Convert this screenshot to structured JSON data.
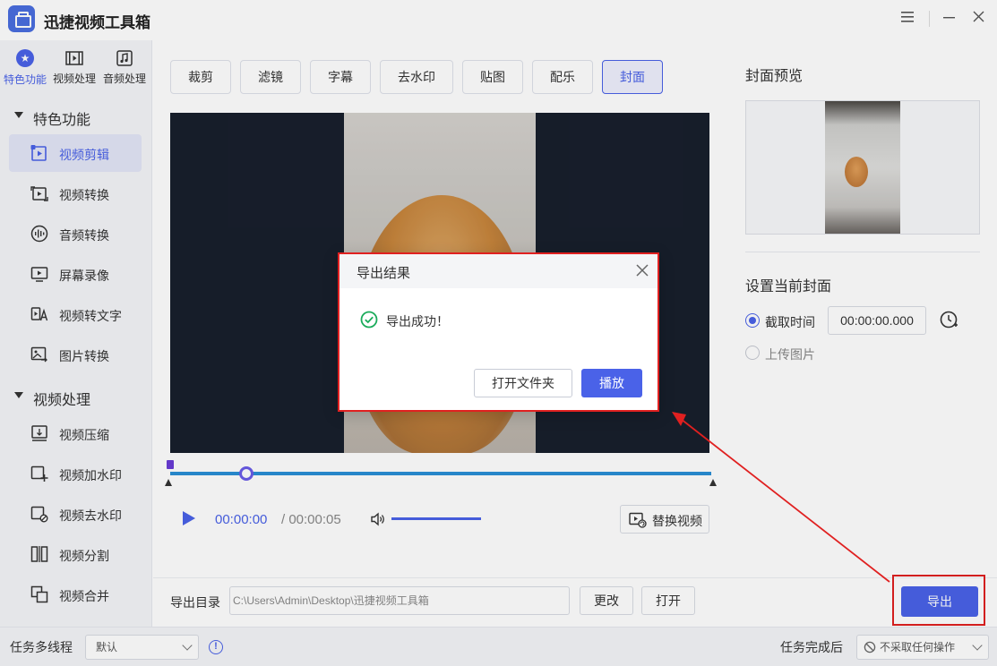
{
  "app": {
    "title": "迅捷视频工具箱"
  },
  "sidebar": {
    "top_tabs": [
      {
        "label": "特色功能",
        "icon": "star-icon",
        "active": true
      },
      {
        "label": "视频处理",
        "icon": "film-icon",
        "active": false
      },
      {
        "label": "音频处理",
        "icon": "music-icon",
        "active": false
      }
    ],
    "groups": [
      {
        "label": "特色功能",
        "items": [
          {
            "label": "视频剪辑",
            "icon": "video-edit-icon",
            "active": true
          },
          {
            "label": "视频转换",
            "icon": "video-convert-icon",
            "active": false
          },
          {
            "label": "音频转换",
            "icon": "audio-convert-icon",
            "active": false
          },
          {
            "label": "屏幕录像",
            "icon": "screen-record-icon",
            "active": false
          },
          {
            "label": "视频转文字",
            "icon": "video-to-text-icon",
            "active": false
          },
          {
            "label": "图片转换",
            "icon": "image-convert-icon",
            "active": false
          }
        ]
      },
      {
        "label": "视频处理",
        "items": [
          {
            "label": "视频压缩",
            "icon": "video-compress-icon",
            "active": false
          },
          {
            "label": "视频加水印",
            "icon": "add-watermark-icon",
            "active": false
          },
          {
            "label": "视频去水印",
            "icon": "remove-watermark-icon",
            "active": false
          },
          {
            "label": "视频分割",
            "icon": "video-split-icon",
            "active": false
          },
          {
            "label": "视频合并",
            "icon": "video-merge-icon",
            "active": false
          }
        ]
      }
    ]
  },
  "tool_tabs": [
    {
      "label": "裁剪",
      "active": false
    },
    {
      "label": "滤镜",
      "active": false
    },
    {
      "label": "字幕",
      "active": false
    },
    {
      "label": "去水印",
      "active": false
    },
    {
      "label": "贴图",
      "active": false
    },
    {
      "label": "配乐",
      "active": false
    },
    {
      "label": "封面",
      "active": true
    }
  ],
  "player": {
    "current_time": "00:00:00",
    "total_time": "/ 00:00:05",
    "playhead_fraction": 0.14,
    "volume_fraction": 1.0,
    "replace_label": "替换视频"
  },
  "cover_panel": {
    "preview_title": "封面预览",
    "set_title": "设置当前封面",
    "option_capture": "截取时间",
    "capture_time": "00:00:00.000",
    "option_upload": "上传图片",
    "selected": "capture"
  },
  "export": {
    "dir_label": "导出目录",
    "path": "C:\\Users\\Admin\\Desktop\\迅捷视频工具箱",
    "change_label": "更改",
    "open_label": "打开",
    "export_label": "导出"
  },
  "statusbar": {
    "multithread_label": "任务多线程",
    "multithread_value": "默认",
    "after_label": "任务完成后",
    "after_value": "不采取任何操作"
  },
  "dialog": {
    "title": "导出结果",
    "message": "导出成功！",
    "open_folder_label": "打开文件夹",
    "play_label": "播放"
  },
  "colors": {
    "accent": "#4a62e8",
    "annotation": "#e02020",
    "success": "#1aab5a"
  }
}
